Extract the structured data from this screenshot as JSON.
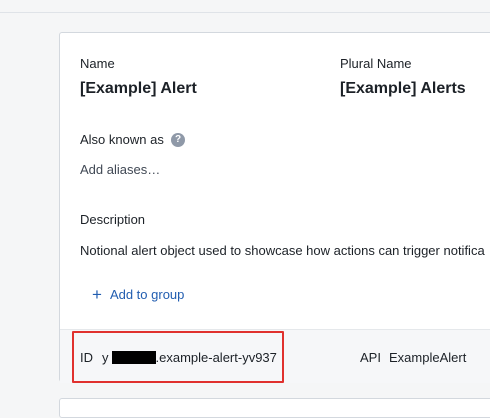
{
  "fields": {
    "name_label": "Name",
    "name_value": "[Example] Alert",
    "plural_label": "Plural Name",
    "plural_value": "[Example] Alerts",
    "aka_label": "Also known as",
    "aka_help_icon": "question-mark",
    "add_aliases": "Add aliases…",
    "description_label": "Description",
    "description_text": "Notional alert object used to showcase how actions can trigger notifica",
    "add_to_group": "Add to group"
  },
  "footer": {
    "id_label": "ID",
    "id_prefix": "y",
    "id_suffix": ".example-alert-yv937",
    "api_label": "API",
    "api_value": "ExampleAlert"
  },
  "colors": {
    "accent_blue": "#215db0",
    "highlight_red": "#e0312e",
    "redaction": "#000000"
  }
}
